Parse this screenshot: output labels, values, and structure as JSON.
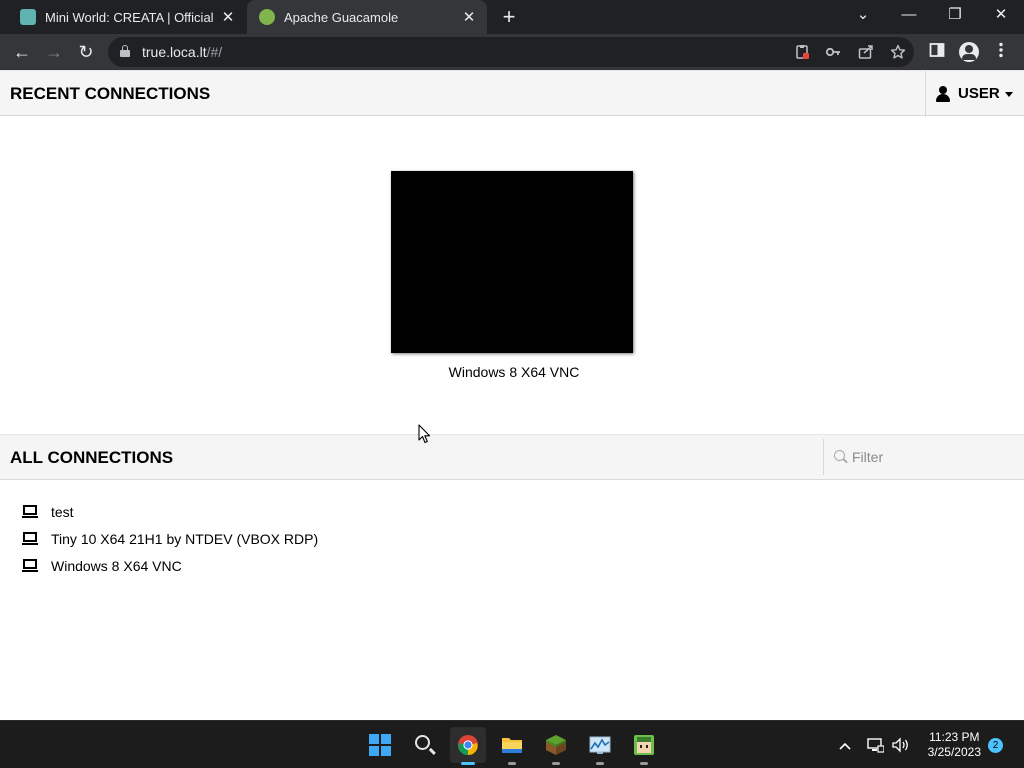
{
  "browser": {
    "tabs": [
      {
        "title": "Mini World: CREATA | Official",
        "favicon": "miniworld-icon",
        "active": false
      },
      {
        "title": "Apache Guacamole",
        "favicon": "guacamole-icon",
        "active": true
      }
    ],
    "close_glyph": "✕",
    "new_tab_glyph": "+",
    "window_controls": {
      "dropdown": "⌄",
      "minimize": "—",
      "restore": "❐",
      "close": "✕"
    },
    "address": {
      "host": "true.loca.lt",
      "path": "/#/"
    },
    "nav": {
      "back": "←",
      "forward": "→",
      "reload": "↻"
    }
  },
  "guacamole": {
    "recent_heading": "RECENT CONNECTIONS",
    "user_menu_label": "USER",
    "recent": [
      {
        "name": "Windows 8 X64 VNC"
      }
    ],
    "all_heading": "ALL CONNECTIONS",
    "filter_placeholder": "Filter",
    "connections": [
      {
        "name": "test"
      },
      {
        "name": "Tiny 10 X64 21H1 by NTDEV (VBOX RDP)"
      },
      {
        "name": "Windows 8 X64 VNC"
      }
    ]
  },
  "taskbar": {
    "time": "11:23 PM",
    "date": "3/25/2023",
    "notification_count": "2",
    "accent": "#4cc2ff"
  }
}
